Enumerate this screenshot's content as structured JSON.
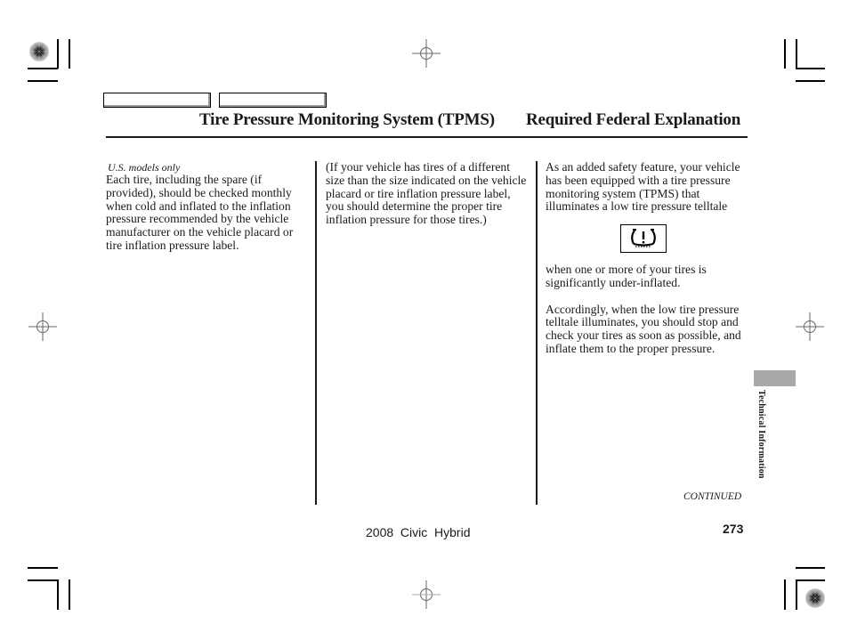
{
  "header": {
    "nav_tabs": [
      "",
      ""
    ],
    "title_left": "Tire Pressure Monitoring System (TPMS)",
    "title_right": "Required Federal Explanation"
  },
  "columns": {
    "col1": {
      "note": "U.S. models only",
      "paragraph": "Each tire, including the spare (if provided), should be checked monthly when cold and inflated to the inflation pressure recommended by the vehicle manufacturer on the vehicle placard or tire inflation pressure label."
    },
    "col2": {
      "paragraph": "(If your vehicle has tires of a different size than the size indicated on the vehicle placard or tire inflation pressure label, you should determine the proper tire inflation pressure for those tires.)"
    },
    "col3": {
      "paragraph1": "As an added safety feature, your vehicle has been equipped with a tire pressure monitoring system (TPMS) that illuminates a low tire pressure telltale",
      "icon": "low-tire-pressure-telltale-icon",
      "paragraph2": "when one or more of your tires is significantly under-inflated.",
      "paragraph3": "Accordingly, when the low tire pressure telltale illuminates, you should stop and check your tires as soon as possible, and inflate them to the proper pressure."
    }
  },
  "side_tab": {
    "label": "Technical Information",
    "color": "#a9a9a9"
  },
  "continued": "CONTINUED",
  "page_number": "273",
  "footer": "2008  Civic  Hybrid"
}
